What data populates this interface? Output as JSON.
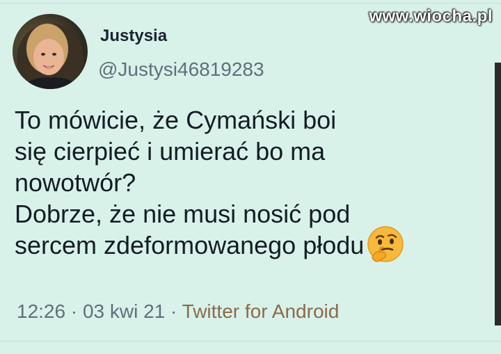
{
  "watermark": "www.wiocha.pl",
  "user": {
    "name": "Justysia",
    "handle": "@Justysi46819283"
  },
  "tweet": {
    "lines": [
      "To mówicie, że Cymański boi",
      "się cierpieć i umierać bo ma",
      "nowotwór?",
      "Dobrze, że nie musi nosić pod",
      "sercem zdeformowanego płodu"
    ],
    "emoji": "thinking-face-icon"
  },
  "meta": {
    "time": "12:26",
    "separator1": " · ",
    "date": "03 kwi 21",
    "separator2": " · ",
    "source": "Twitter for Android"
  },
  "colors": {
    "background": "#d8f2ea",
    "text": "#141c24",
    "secondary": "#5f6f7a",
    "source": "#8a6a4a"
  }
}
